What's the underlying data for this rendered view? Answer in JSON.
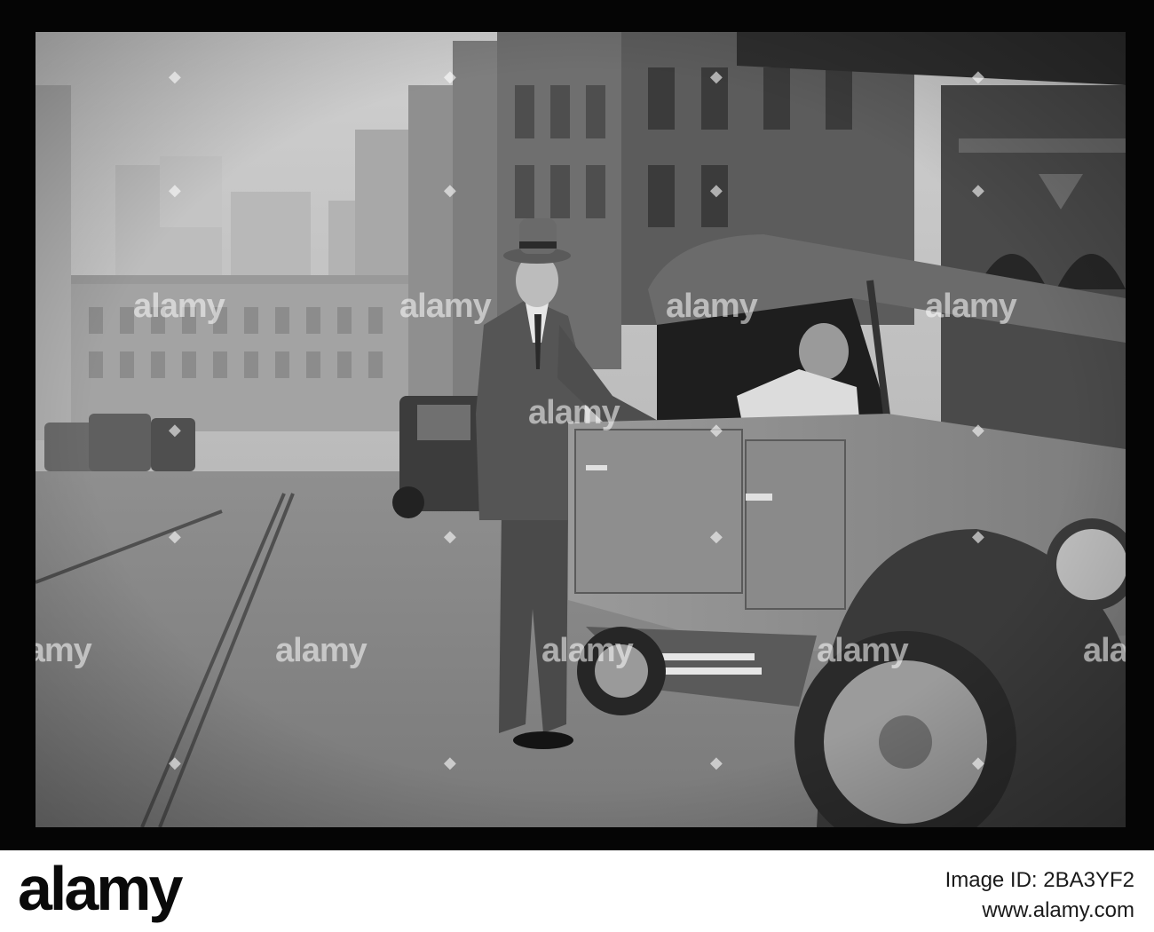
{
  "watermark": {
    "text": "alamy",
    "color": "#ffffff"
  },
  "footer": {
    "logo": "alamy",
    "image_id_line": "Image ID: 2BA3YF2",
    "site_line": "www.alamy.com"
  },
  "colors": {
    "border": "#050505",
    "footer_background": "#ffffff",
    "footer_text": "#1a1a1a"
  }
}
